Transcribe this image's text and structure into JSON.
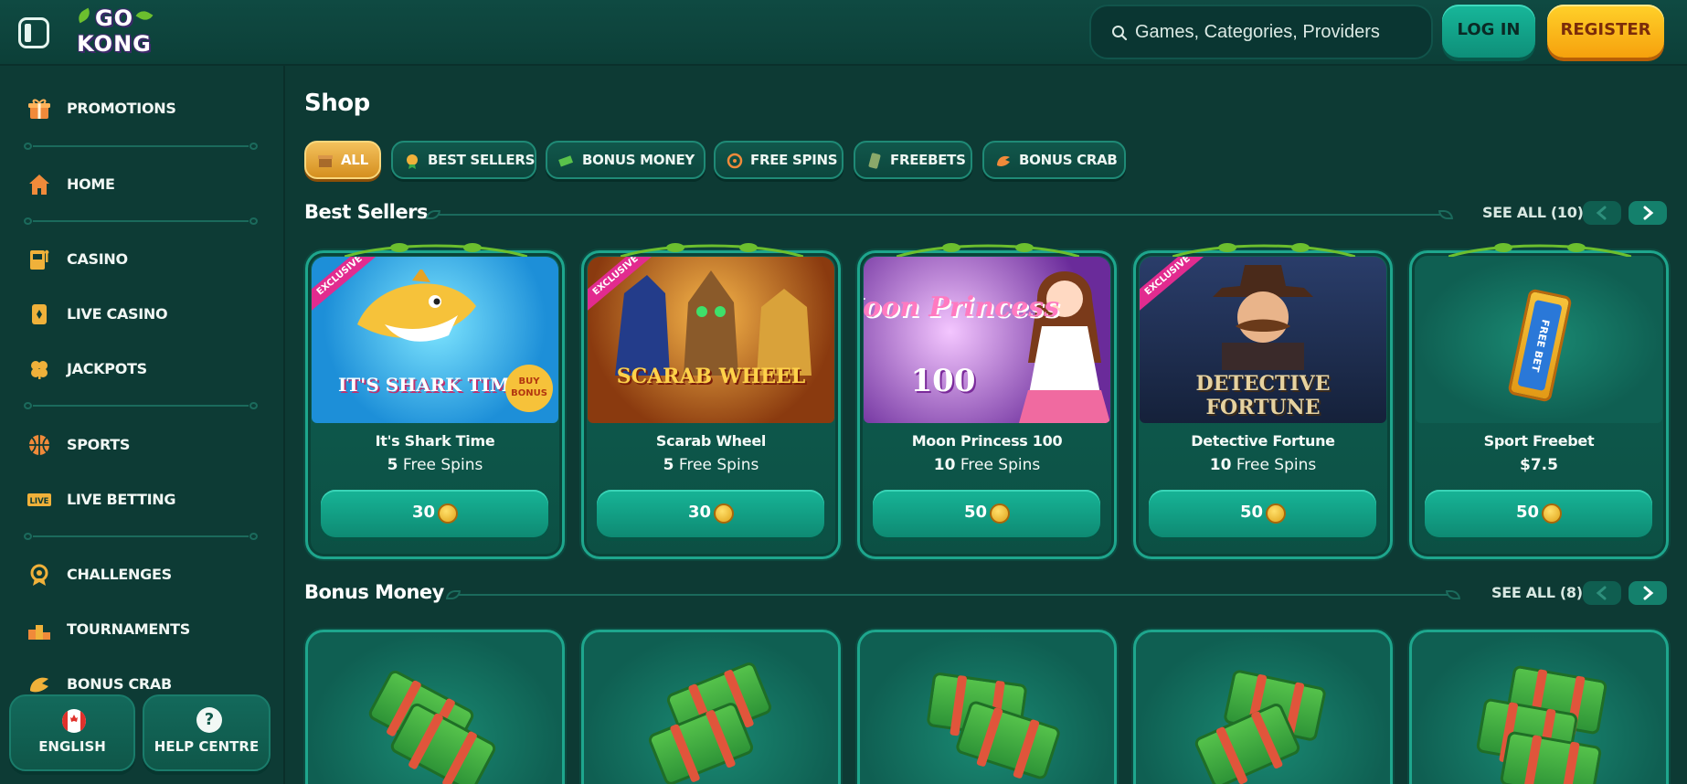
{
  "header": {
    "logo_line1": "GO",
    "logo_line2": "KONG",
    "search_placeholder": "Games, Categories, Providers",
    "login_label": "LOG IN",
    "register_label": "REGISTER"
  },
  "sidebar": {
    "items": [
      {
        "label": "PROMOTIONS",
        "icon": "gift-icon"
      },
      {
        "label": "HOME",
        "icon": "home-icon"
      },
      {
        "label": "CASINO",
        "icon": "slot-machine-icon"
      },
      {
        "label": "LIVE CASINO",
        "icon": "card-icon"
      },
      {
        "label": "JACKPOTS",
        "icon": "clover-icon"
      },
      {
        "label": "SPORTS",
        "icon": "basketball-icon"
      },
      {
        "label": "LIVE BETTING",
        "icon": "live-badge-icon"
      },
      {
        "label": "CHALLENGES",
        "icon": "badge-icon"
      },
      {
        "label": "TOURNAMENTS",
        "icon": "podium-icon"
      },
      {
        "label": "BONUS CRAB",
        "icon": "crab-icon"
      }
    ],
    "live_badge_text": "LIVE",
    "language_label": "ENGLISH",
    "help_label": "HELP CENTRE",
    "help_glyph": "?"
  },
  "main": {
    "page_title": "Shop",
    "filters": [
      {
        "label": "ALL",
        "active": true
      },
      {
        "label": "BEST SELLERS",
        "active": false
      },
      {
        "label": "BONUS MONEY",
        "active": false
      },
      {
        "label": "FREE SPINS",
        "active": false
      },
      {
        "label": "FREEBETS",
        "active": false
      },
      {
        "label": "BONUS CRAB",
        "active": false
      }
    ],
    "sections": [
      {
        "title": "Best Sellers",
        "see_all": "SEE ALL (10)"
      },
      {
        "title": "Bonus Money",
        "see_all": "SEE ALL (8)"
      }
    ],
    "best_sellers": [
      {
        "title": "It's Shark Time",
        "amount": "5",
        "unit": "Free Spins",
        "price": "30",
        "exclusive": "EXCLUSIVE",
        "art_text": "IT'S SHARK TIME!",
        "art_badge": "BUY BONUS"
      },
      {
        "title": "Scarab Wheel",
        "amount": "5",
        "unit": "Free Spins",
        "price": "30",
        "exclusive": "EXCLUSIVE",
        "art_text": "SCARAB WHEEL"
      },
      {
        "title": "Moon Princess 100",
        "amount": "10",
        "unit": "Free Spins",
        "price": "50",
        "art_text": "Moon Princess",
        "art_num": "100"
      },
      {
        "title": "Detective Fortune",
        "amount": "10",
        "unit": "Free Spins",
        "price": "50",
        "exclusive": "EXCLUSIVE",
        "art_text": "DETECTIVE FORTUNE"
      },
      {
        "title": "Sport Freebet",
        "amount": "$7.5",
        "unit": "",
        "price": "50",
        "art_text": "FREE BET"
      }
    ]
  },
  "colors": {
    "background": "#0d3a34",
    "accent_teal": "#14a58a",
    "register_yellow": "#f6b21a",
    "active_chip": "#e2a437"
  }
}
